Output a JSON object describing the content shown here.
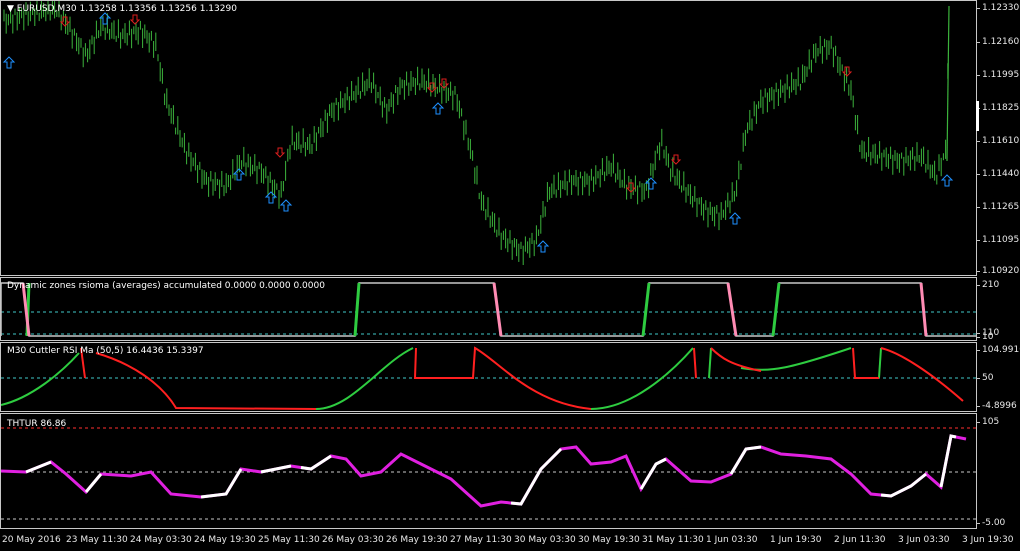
{
  "main": {
    "title": "▼ EURUSD,M30  1.13258 1.13356 1.13256 1.13290",
    "price_ticks": [
      "1.12330",
      "1.12160",
      "1.11995",
      "1.11825",
      "1.11610",
      "1.11440",
      "1.11265",
      "1.11095",
      "1.10920"
    ],
    "candle_color": "#3cb43c",
    "up_arrow_color": "#1e90ff",
    "down_arrow_color": "#dc1e1e",
    "up_arrow_icon": "up-arrow-icon",
    "down_arrow_icon": "down-arrow-icon"
  },
  "pane1": {
    "title": "Dynamic zones rsioma (averages) accumulated 0.0000 0.0000 0.0000",
    "ticks": [
      "210",
      "110",
      "10"
    ],
    "line_color": "#c8c8c8",
    "up_color": "#2ecc40",
    "down_color": "#ff8cb4",
    "level_color": "#40c8c8"
  },
  "pane2": {
    "title": "M30 Cuttler RSI Ma (50,5) 16.4436 15.3397",
    "ticks": [
      "104.9916",
      "50",
      "-4.8996"
    ],
    "up_color": "#2ecc40",
    "down_color": "#ff2020",
    "level_color": "#40c8c8"
  },
  "pane3": {
    "title": "THTUR 86.86",
    "ticks": [
      "105",
      "-5.00"
    ],
    "line_color": "#e020e0",
    "alt_color": "#ffffff",
    "top_level_color": "#ff3030",
    "mid_level_color": "#c8c8c8"
  },
  "time_labels": [
    "20 May 2016",
    "23 May 11:30",
    "24 May 03:30",
    "24 May 19:30",
    "25 May 11:30",
    "26 May 03:30",
    "26 May 19:30",
    "27 May 11:30",
    "30 May 03:30",
    "30 May 19:30",
    "31 May 11:30",
    "1 Jun 03:30",
    "1 Jun 19:30",
    "2 Jun 11:30",
    "3 Jun 03:30",
    "3 Jun 19:30"
  ]
}
